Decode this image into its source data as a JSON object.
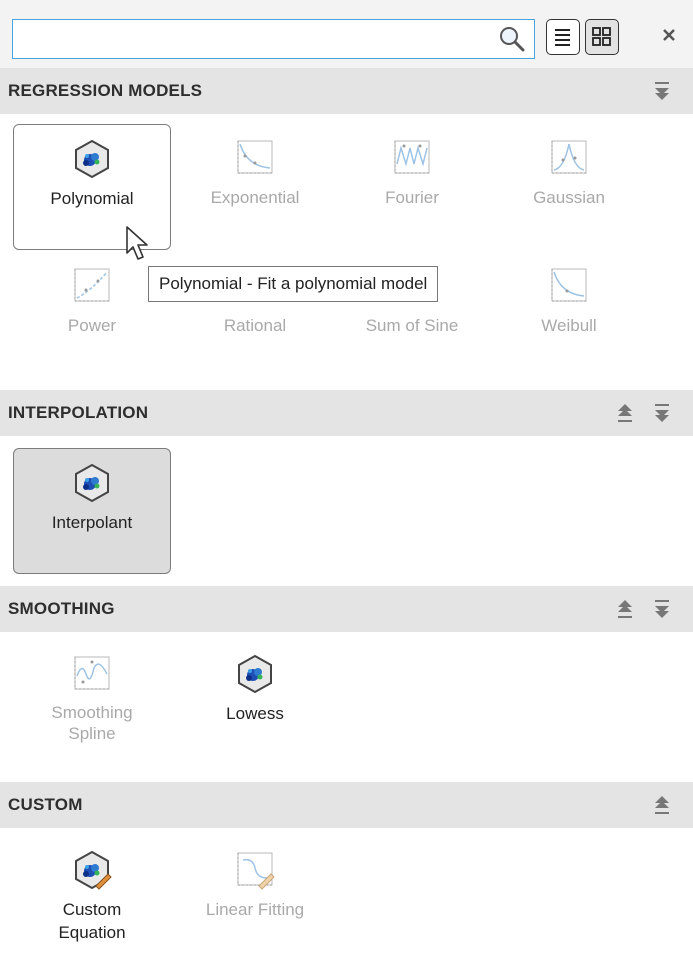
{
  "search": {
    "value": "",
    "placeholder": ""
  },
  "toolbar": {
    "list_view_icon": "list-icon",
    "grid_view_icon": "grid-icon",
    "close_icon": "close-icon"
  },
  "colors": {
    "accent": "#4aa3df",
    "header_bg": "#e4e4e4",
    "disabled_text": "#a9a9a9",
    "selected_tile": "#dcdcdc"
  },
  "sections": {
    "regression": {
      "title": "REGRESSION MODELS",
      "items": [
        {
          "label": "Polynomial",
          "icon": "polynomial-icon",
          "state": "hovered"
        },
        {
          "label": "Exponential",
          "icon": "exponential-icon",
          "state": "disabled"
        },
        {
          "label": "Fourier",
          "icon": "fourier-icon",
          "state": "disabled"
        },
        {
          "label": "Gaussian",
          "icon": "gaussian-icon",
          "state": "disabled"
        },
        {
          "label": "Power",
          "icon": "power-icon",
          "state": "disabled"
        },
        {
          "label": "Rational",
          "icon": "rational-icon",
          "state": "disabled"
        },
        {
          "label": "Sum of Sine",
          "icon": "sum-of-sine-icon",
          "state": "disabled"
        },
        {
          "label": "Weibull",
          "icon": "weibull-icon",
          "state": "disabled"
        }
      ]
    },
    "interpolation": {
      "title": "INTERPOLATION",
      "items": [
        {
          "label": "Interpolant",
          "icon": "interpolant-icon",
          "state": "selected"
        }
      ]
    },
    "smoothing": {
      "title": "SMOOTHING",
      "items": [
        {
          "label_line1": "Smoothing",
          "label_line2": "Spline",
          "icon": "smoothing-spline-icon",
          "state": "disabled"
        },
        {
          "label": "Lowess",
          "icon": "lowess-icon",
          "state": "enabled"
        }
      ]
    },
    "custom": {
      "title": "CUSTOM",
      "items": [
        {
          "label_line1": "Custom",
          "label_line2": "Equation",
          "icon": "custom-equation-icon",
          "state": "enabled"
        },
        {
          "label": "Linear Fitting",
          "icon": "linear-fitting-icon",
          "state": "disabled"
        }
      ]
    }
  },
  "tooltip": {
    "text": "Polynomial - Fit a polynomial model"
  }
}
